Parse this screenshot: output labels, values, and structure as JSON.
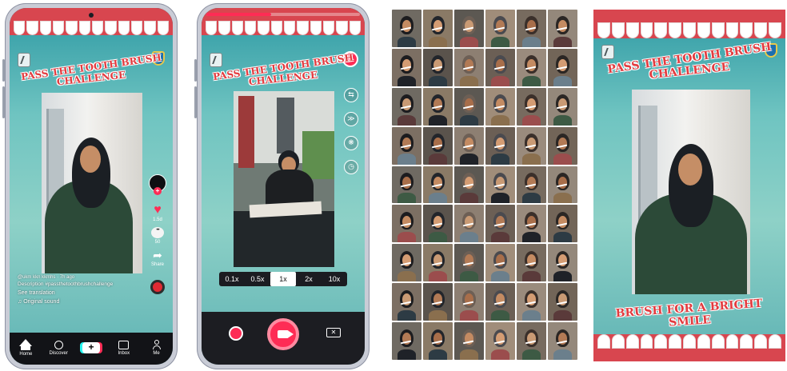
{
  "challenge": {
    "line1": "PASS THE TOOTH BRUSH",
    "line2": "CHALLENGE",
    "slogan": "BRUSH FOR A BRIGHT SMILE",
    "colors": {
      "gum": "#d8464f",
      "teal": "#6fc4c1",
      "accent": "#fe2c55"
    }
  },
  "feed_phone": {
    "rail": {
      "likes": "1.5d",
      "comments": "50",
      "share_label": "Share"
    },
    "caption": {
      "user": "@ukm kkn kkmhs",
      "time": "7h ago",
      "description_label": "Description",
      "hashtag": "#passthetoothbrushchallenge",
      "see_translation": "See translation",
      "sound": "♫ Original sound"
    },
    "tabs": [
      {
        "label": "Home",
        "icon": "home-icon"
      },
      {
        "label": "Discover",
        "icon": "search-icon"
      },
      {
        "label": "",
        "icon": "create-icon"
      },
      {
        "label": "Inbox",
        "icon": "inbox-icon"
      },
      {
        "label": "Me",
        "icon": "profile-icon"
      }
    ]
  },
  "record_phone": {
    "progress": 0.42,
    "tools": [
      "flip-icon",
      "speed-icon",
      "filter-icon",
      "timer-icon"
    ],
    "speeds": [
      "0.1x",
      "0.5x",
      "1x",
      "2x",
      "10x"
    ],
    "active_speed": "1x"
  },
  "grid_palette": [
    "#6f6a62",
    "#8a7a66",
    "#5c5852",
    "#a08d7a",
    "#776b5f",
    "#94887b",
    "#7c6f63",
    "#5a534c",
    "#8d7f72",
    "#6b5f55",
    "#9a8b7d",
    "#726558"
  ]
}
